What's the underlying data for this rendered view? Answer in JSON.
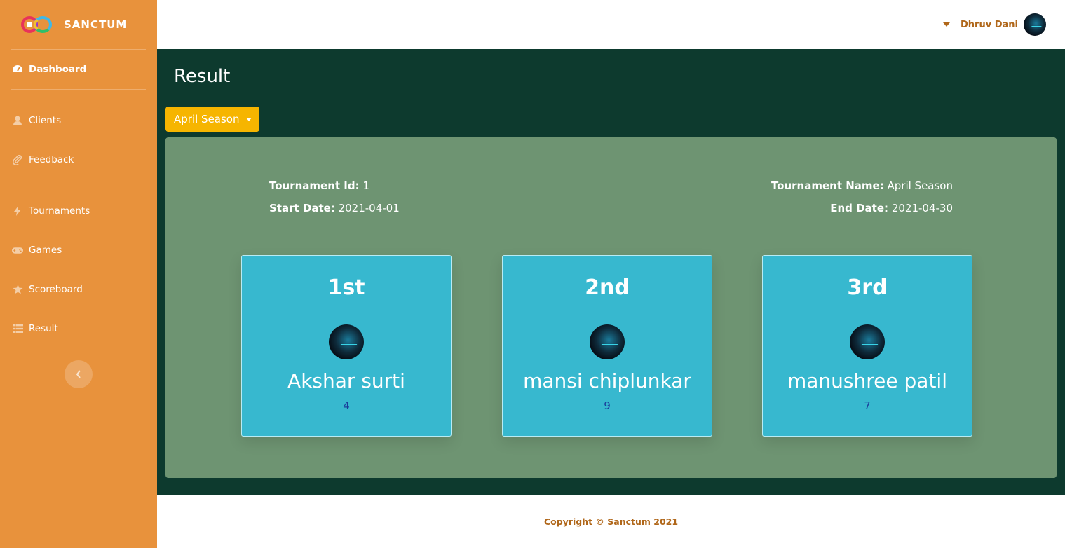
{
  "brand": {
    "name": "SANCTUM",
    "logo_icon": "sanctum-logo-icon"
  },
  "sidebar": {
    "items": [
      {
        "label": "Dashboard",
        "icon": "tachometer-icon",
        "active": true
      },
      {
        "label": "Clients",
        "icon": "user-icon"
      },
      {
        "label": "Feedback",
        "icon": "paperclip-icon"
      },
      {
        "label": "Tournaments",
        "icon": "bolt-icon"
      },
      {
        "label": "Games",
        "icon": "gamepad-icon"
      },
      {
        "label": "Scoreboard",
        "icon": "star-icon"
      },
      {
        "label": "Result",
        "icon": "list-icon"
      }
    ],
    "toggle_icon": "chevron-left-icon"
  },
  "topbar": {
    "user_name": "Dhruv Dani"
  },
  "page": {
    "title": "Result",
    "season_dropdown": "April Season",
    "tournament": {
      "id_label": "Tournament Id:",
      "id_value": "1",
      "start_label": "Start Date:",
      "start_value": "2021-04-01",
      "name_label": "Tournament Name:",
      "name_value": "April Season",
      "end_label": "End Date:",
      "end_value": "2021-04-30"
    },
    "winners": [
      {
        "rank": "1st",
        "name": "Akshar surti",
        "score": "4"
      },
      {
        "rank": "2nd",
        "name": "mansi chiplunkar",
        "score": "9"
      },
      {
        "rank": "3rd",
        "name": "manushree patil",
        "score": "7"
      }
    ]
  },
  "footer": {
    "text": "Copyright © Sanctum 2021"
  },
  "colors": {
    "sidebar": "#e8923c",
    "content_bg": "#0d3a2e",
    "panel": "#6e9472",
    "card": "#37b8cf",
    "button": "#f6b500"
  }
}
